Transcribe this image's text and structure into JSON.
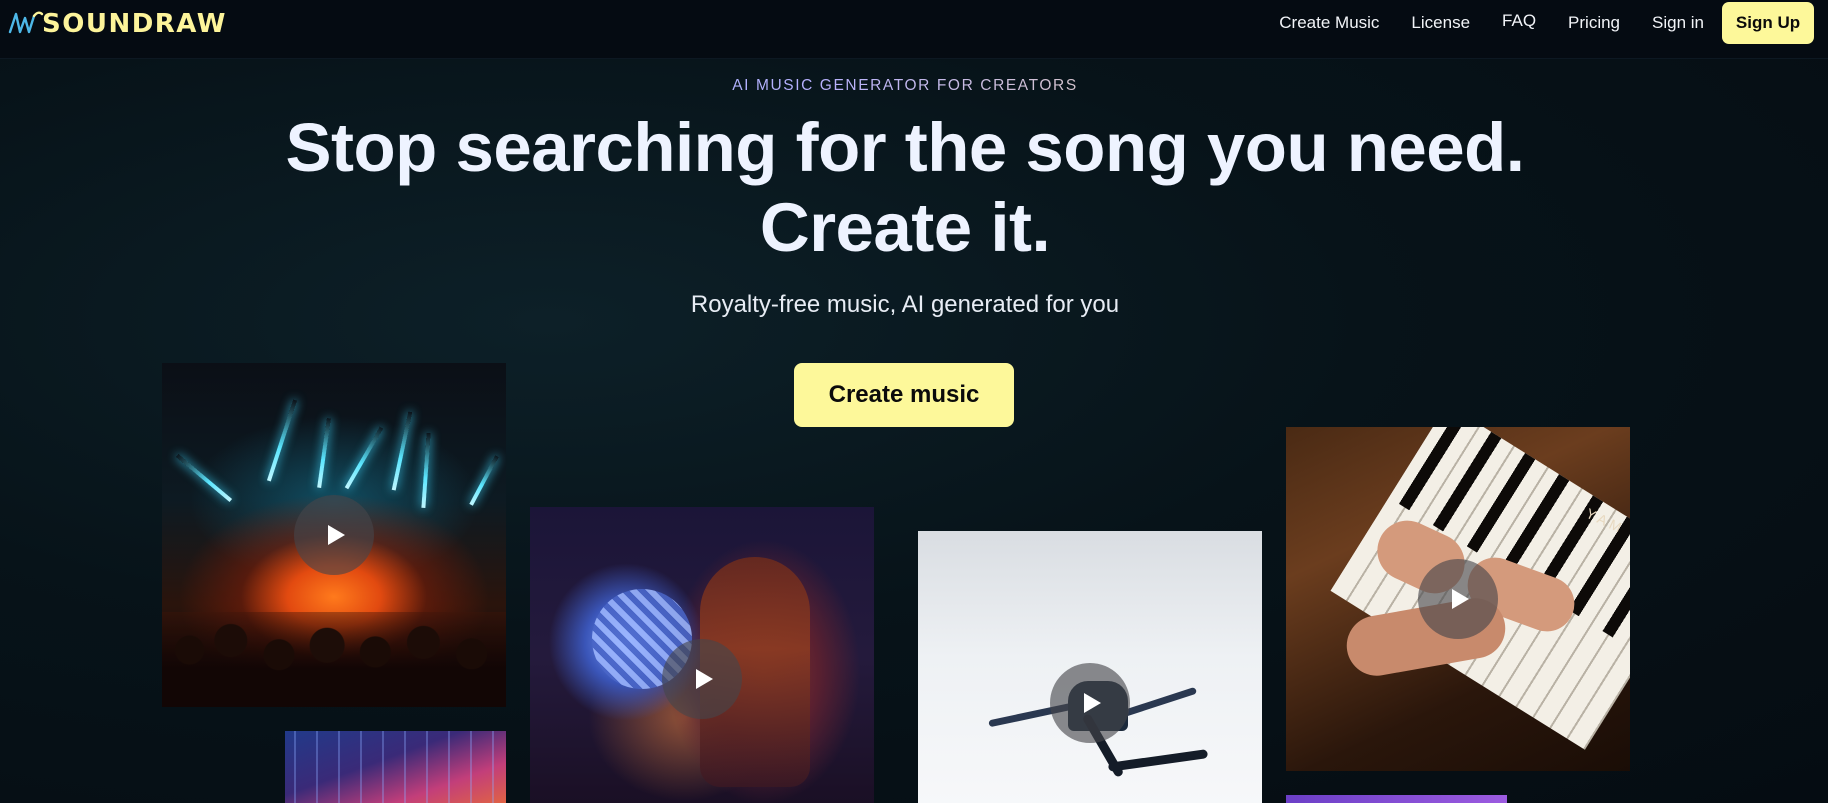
{
  "nav": {
    "logo_text": "SOUNDRAW",
    "links": [
      "Create Music",
      "License",
      "FAQ",
      "Pricing",
      "Sign in"
    ],
    "signup_label": "Sign Up"
  },
  "hero": {
    "eyebrow": "AI MUSIC GENERATOR FOR CREATORS",
    "headline_line1": "Stop searching for the song you need.",
    "headline_line2": "Create it.",
    "subheadline": "Royalty-free music, AI generated for you",
    "cta_label": "Create music"
  },
  "tiles": [
    {
      "scene": "concert-lasers",
      "has_play": true
    },
    {
      "scene": "city-night",
      "has_play": false
    },
    {
      "scene": "disco-ball-woman",
      "has_play": true
    },
    {
      "scene": "dancer-white-room",
      "has_play": true
    },
    {
      "scene": "piano-hands",
      "has_play": true,
      "brand_text": "YAM"
    },
    {
      "scene": "purple-partial",
      "has_play": false
    }
  ],
  "colors": {
    "accent": "#fdf89a",
    "logo": "#fdf49a",
    "background": "#061018",
    "nav_background": "#050b12"
  },
  "icons": [
    "logo-wave-icon",
    "play-icon"
  ]
}
